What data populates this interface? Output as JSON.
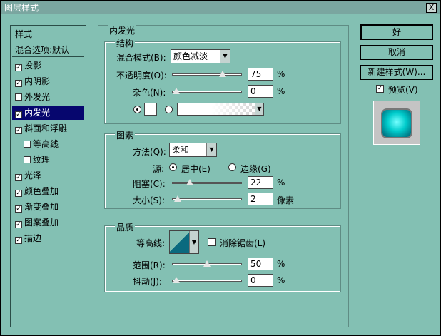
{
  "title": "图层样式",
  "close_glyph": "X",
  "sidebar": {
    "header": "样式",
    "blend": "混合选项:默认",
    "items": [
      {
        "label": "投影",
        "checked": true
      },
      {
        "label": "内阴影",
        "checked": true
      },
      {
        "label": "外发光",
        "checked": false
      },
      {
        "label": "内发光",
        "checked": true
      },
      {
        "label": "斜面和浮雕",
        "checked": true
      },
      {
        "label": "等高线",
        "checked": false
      },
      {
        "label": "纹理",
        "checked": false
      },
      {
        "label": "光泽",
        "checked": true
      },
      {
        "label": "颜色叠加",
        "checked": true
      },
      {
        "label": "渐变叠加",
        "checked": true
      },
      {
        "label": "图案叠加",
        "checked": true
      },
      {
        "label": "描边",
        "checked": true
      }
    ],
    "check": "☑"
  },
  "inner_glow": {
    "heading": "内发光",
    "structure": {
      "title": "结构",
      "blend_mode_label": "混合模式(B):",
      "blend_mode_value": "颜色减淡",
      "opacity_label": "不透明度(O):",
      "opacity_value": "75",
      "noise_label": "杂色(N):",
      "noise_value": "0",
      "percent": "%"
    },
    "elements": {
      "title": "图素",
      "technique_label": "方法(Q):",
      "technique_value": "柔和",
      "source_label": "源:",
      "center_label": "居中(E)",
      "edge_label": "边缘(G)",
      "choke_label": "阻塞(C):",
      "choke_value": "22",
      "size_label": "大小(S):",
      "size_value": "2",
      "size_unit": "像素",
      "percent": "%"
    },
    "quality": {
      "title": "品质",
      "contour_label": "等高线:",
      "antialias_label": "消除锯齿(L)",
      "range_label": "范围(R):",
      "range_value": "50",
      "jitter_label": "抖动(J):",
      "jitter_value": "0",
      "percent": "%"
    }
  },
  "buttons": {
    "ok": "好",
    "cancel": "取消",
    "new_style": "新建样式(W)...",
    "preview_label": "预览(V)"
  },
  "sliders": {
    "opacity": 0.75,
    "noise": 0.0,
    "choke": 0.22,
    "size": 0.02,
    "range": 0.5,
    "jitter": 0.0
  }
}
